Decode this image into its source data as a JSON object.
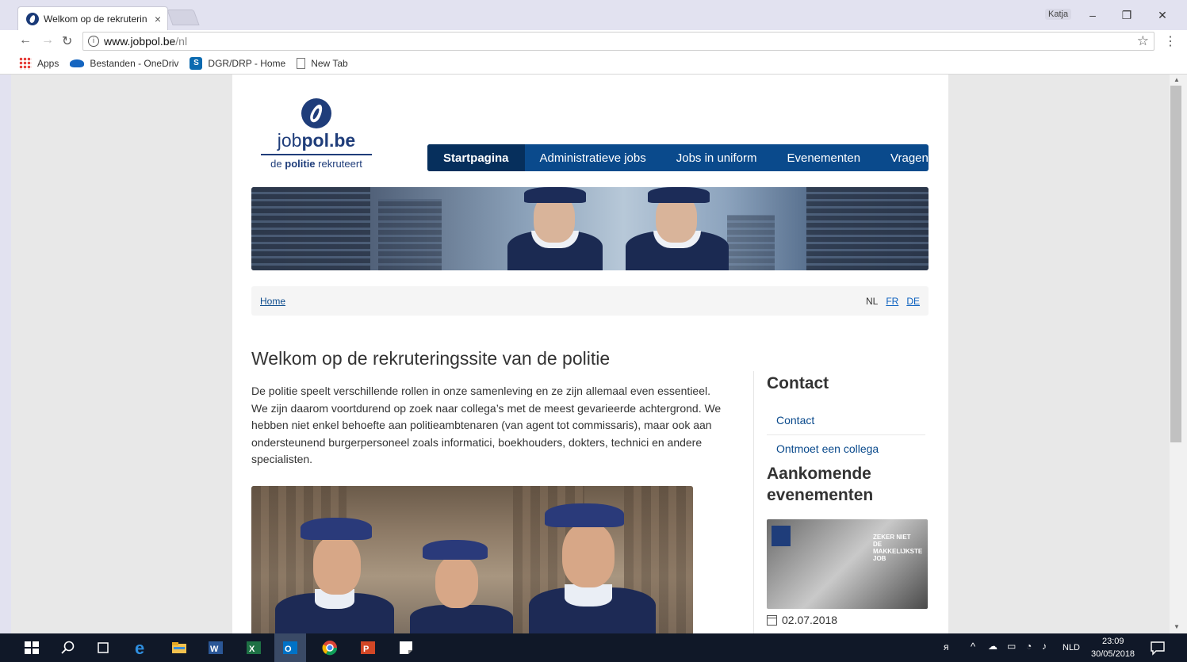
{
  "browser": {
    "tab_title": "Welkom op de rekruterin",
    "tab_close": "×",
    "profile_name": "Katja",
    "window_controls": [
      "–",
      "❐",
      "✕"
    ],
    "url_domain": "www.jobpol.be",
    "url_path": "/nl",
    "bookmarks": [
      {
        "label": "Apps",
        "icon": "apps-icon"
      },
      {
        "label": "Bestanden - OneDriv",
        "icon": "onedrive-icon"
      },
      {
        "label": "DGR/DRP - Home",
        "icon": "sharepoint-icon"
      },
      {
        "label": "New Tab",
        "icon": "page-icon"
      }
    ]
  },
  "site": {
    "logo_name_plain": "job",
    "logo_name_bold": "pol.be",
    "logo_tag_plain_1": "de",
    "logo_tag_bold": "politie",
    "logo_tag_plain_2": "rekruteert",
    "nav": [
      "Startpagina",
      "Administratieve jobs",
      "Jobs in uniform",
      "Evenementen",
      "Vragen"
    ],
    "breadcrumb_home": "Home",
    "languages": {
      "current": "NL",
      "links": [
        "FR",
        "DE"
      ]
    },
    "title": "Welkom op de rekruteringssite van de politie",
    "intro": "De politie speelt verschillende rollen in onze samenleving en ze zijn allemaal even essentieel. We zijn daarom voortdurend op zoek naar collega’s met de meest gevarieerde achtergrond. We hebben niet enkel behoefte aan politieambtenaren (van agent tot commissaris), maar ook aan ondersteunend burgerpersoneel zoals informatici, boekhouders, dokters, technici en andere specialisten.",
    "sidebar": {
      "contact_title": "Contact",
      "contact_links": [
        "Contact",
        "Ontmoet een collega"
      ],
      "events_title": "Aankomende evenementen",
      "event_image_text": [
        "ZEKER NIET",
        "DE MAKKELIJKSTE JOB"
      ],
      "event_date": "02.07.2018"
    }
  },
  "taskbar": {
    "language": "NLD",
    "time": "23:09",
    "date": "30/05/2018"
  }
}
